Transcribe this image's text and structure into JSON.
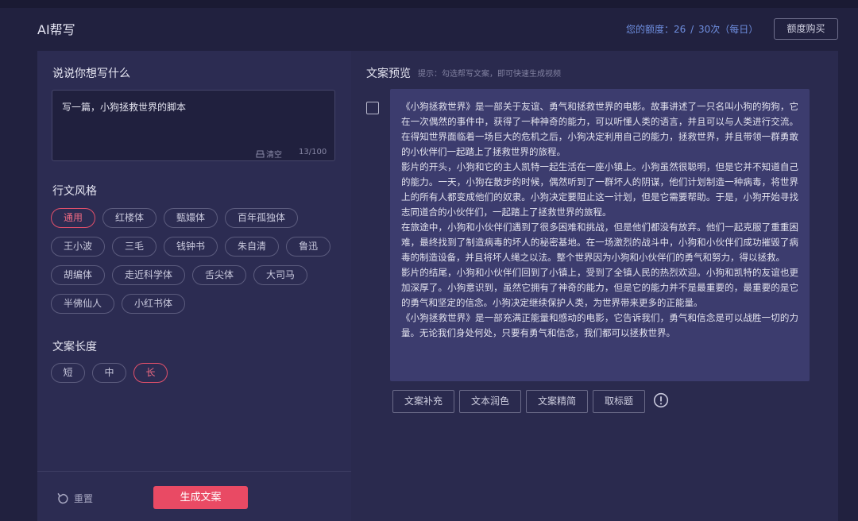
{
  "header": {
    "app_title": "AI帮写",
    "quota_label": "您的额度：",
    "quota_used": "26",
    "quota_total": "30次（每日）",
    "buy_button": "额度购买"
  },
  "left": {
    "prompt_title": "说说你想写什么",
    "prompt_value": "写一篇，小狗拯救世界的脚本",
    "clear_label": "清空",
    "char_count": "13/100",
    "style_title": "行文风格",
    "styles": [
      "通用",
      "红楼体",
      "甄嬛体",
      "百年孤独体",
      "王小波",
      "三毛",
      "钱钟书",
      "朱自清",
      "鲁迅",
      "胡编体",
      "走近科学体",
      "舌尖体",
      "大司马",
      "半佛仙人",
      "小红书体"
    ],
    "selected_style": "通用",
    "length_title": "文案长度",
    "lengths": [
      "短",
      "中",
      "长"
    ],
    "selected_length": "长",
    "reset_label": "重置",
    "generate_label": "生成文案"
  },
  "right": {
    "preview_title": "文案预览",
    "preview_hint": "提示：勾选帮写文案，即可快速生成视频",
    "paragraphs": [
      "《小狗拯救世界》是一部关于友谊、勇气和拯救世界的电影。故事讲述了一只名叫小狗的狗狗，它在一次偶然的事件中，获得了一种神奇的能力，可以听懂人类的语言，并且可以与人类进行交流。在得知世界面临着一场巨大的危机之后，小狗决定利用自己的能力，拯救世界，并且带领一群勇敢的小伙伴们一起踏上了拯救世界的旅程。",
      "影片的开头，小狗和它的主人凯特一起生活在一座小镇上。小狗虽然很聪明，但是它并不知道自己的能力。一天，小狗在散步的时候，偶然听到了一群坏人的阴谋，他们计划制造一种病毒，将世界上的所有人都变成他们的奴隶。小狗决定要阻止这一计划，但是它需要帮助。于是，小狗开始寻找志同道合的小伙伴们，一起踏上了拯救世界的旅程。",
      "在旅途中，小狗和小伙伴们遇到了很多困难和挑战，但是他们都没有放弃。他们一起克服了重重困难，最终找到了制造病毒的坏人的秘密基地。在一场激烈的战斗中，小狗和小伙伴们成功摧毁了病毒的制造设备，并且将坏人绳之以法。整个世界因为小狗和小伙伴们的勇气和努力，得以拯救。",
      "影片的结尾，小狗和小伙伴们回到了小镇上，受到了全镇人民的热烈欢迎。小狗和凯特的友谊也更加深厚了。小狗意识到，虽然它拥有了神奇的能力，但是它的能力并不是最重要的，最重要的是它的勇气和坚定的信念。小狗决定继续保护人类，为世界带来更多的正能量。",
      "《小狗拯救世界》是一部充满正能量和感动的电影，它告诉我们，勇气和信念是可以战胜一切的力量。无论我们身处何处，只要有勇气和信念，我们都可以拯救世界。"
    ],
    "actions": [
      "文案补充",
      "文本润色",
      "文案精简",
      "取标题"
    ]
  }
}
